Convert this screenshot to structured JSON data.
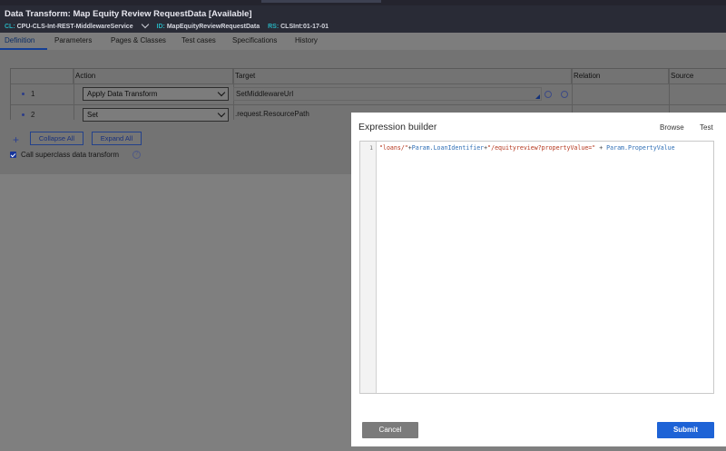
{
  "window": {
    "title": "Data Transform: Map Equity Review RequestData [Available]",
    "meta": [
      {
        "key": "CL:",
        "value": "CPU-CLS-Int-REST-MiddlewareService"
      },
      {
        "key": "ID:",
        "value": "MapEquityReviewRequestData"
      },
      {
        "key": "RS:",
        "value": "CLSInt:01-17-01"
      }
    ]
  },
  "tabs": [
    "Definition",
    "Parameters",
    "Pages & Classes",
    "Test cases",
    "Specifications",
    "History"
  ],
  "grid": {
    "headers": {
      "action": "Action",
      "target": "Target",
      "relation": "Relation",
      "source": "Source"
    },
    "rows": [
      {
        "num": "1",
        "action": "Apply Data Transform",
        "target": "SetMiddlewareUrl"
      },
      {
        "num": "2",
        "action": "Set",
        "target": ".request.ResourcePath"
      }
    ]
  },
  "controls": {
    "add_symbol": "+",
    "collapse_all": "Collapse All",
    "expand_all": "Expand All",
    "call_superclass": "Call superclass data transform",
    "help_symbol": "?"
  },
  "expression_builder": {
    "title": "Expression builder",
    "browse": "Browse",
    "test": "Test",
    "line_number": "1",
    "code": {
      "s1": "\"loans/\"",
      "op1": "+",
      "p1": "Param.LoanIdentifier",
      "op2": "+",
      "s2": "\"/equityreview?propertyValue=\"",
      "op3": " + ",
      "p2": "Param.PropertyValue"
    },
    "cancel": "Cancel",
    "submit": "Submit"
  },
  "colors": {
    "accent_blue": "#1e63d6",
    "header_bg": "#292b36",
    "key_teal": "#27b1bd"
  }
}
